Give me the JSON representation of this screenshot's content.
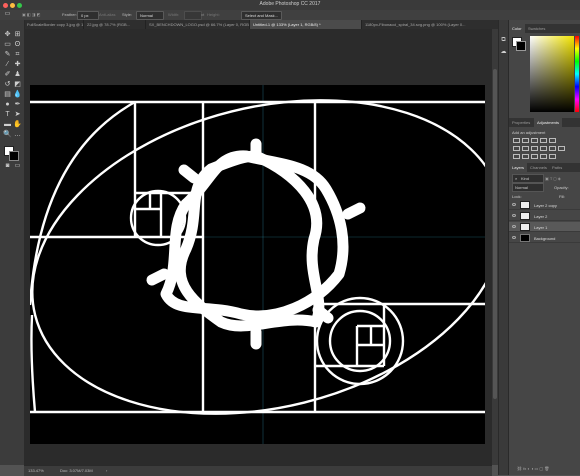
{
  "window": {
    "title": "Adobe Photoshop CC 2017"
  },
  "options": {
    "feather_label": "Feather:",
    "feather_value": "0 px",
    "antialias_label": "Anti-alias",
    "style_label": "Style:",
    "style_value": "Normal",
    "width_label": "Width:",
    "height_label": "Height:",
    "select_mask_button": "Select and Mask..."
  },
  "tabs": [
    "FullScaleBorder copy 3.jpg @ 100% (RGB...",
    "22.jpg @ 78.7% (RGB...",
    "SX_BENCHDOWN_LOGO.psd @ 66.7% (Layer 0, RGB...",
    "Untitled-1 @ 133% (Layer 1, RGB/8) *",
    "1180px-Fibonacci_spiral_34.svg.png @ 100% (Layer 0..."
  ],
  "status": {
    "zoom": "133.47%",
    "doc": "Doc: 3.07M/7.03M"
  },
  "color_panel": {
    "tab_color": "Color",
    "tab_swatches": "Swatches"
  },
  "adjustments_panel": {
    "tab_properties": "Properties",
    "tab_adjustments": "Adjustments",
    "add_label": "Add an adjustment"
  },
  "layers_panel": {
    "tab_layers": "Layers",
    "tab_channels": "Channels",
    "tab_paths": "Paths",
    "kind_label": "Kind",
    "blend_mode": "Normal",
    "opacity_label": "Opacity:",
    "lock_label": "Lock:",
    "fill_label": "Fill:",
    "layers": [
      {
        "name": "Layer 2 copy",
        "selected": false,
        "thumb": "white"
      },
      {
        "name": "Layer 2",
        "selected": false,
        "thumb": "white"
      },
      {
        "name": "Layer 1",
        "selected": true,
        "thumb": "white"
      },
      {
        "name": "Background",
        "selected": false,
        "thumb": "black"
      }
    ]
  },
  "colors": {
    "canvas_bg": "#000000",
    "art": "#ffffff",
    "guide": "#3fc6e8"
  }
}
